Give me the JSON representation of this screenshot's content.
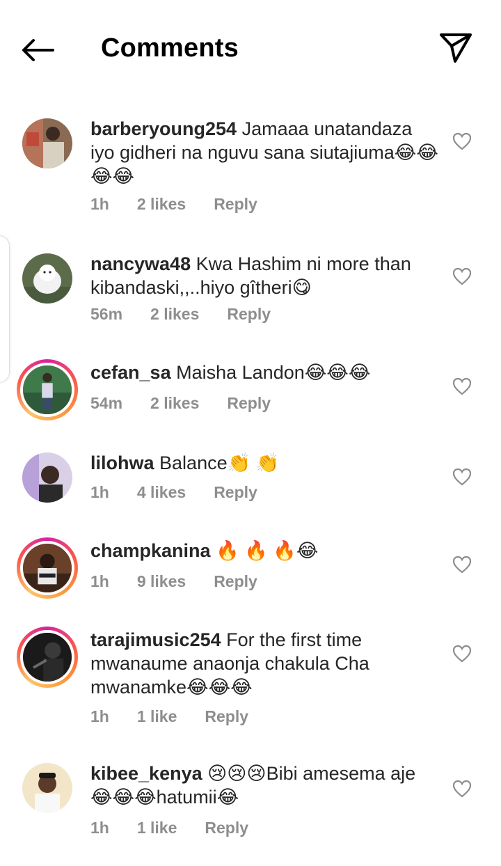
{
  "header": {
    "title": "Comments",
    "back_icon": "arrow-left-icon",
    "share_icon": "send-icon"
  },
  "comments": [
    {
      "username": "barberyoung254",
      "text": "Jamaaa unatandaza iyo gidheri na nguvu sana siutajiuma😂😂😂😂",
      "time": "1h",
      "likes": "2 likes",
      "reply": "Reply"
    },
    {
      "username": "nancywa48",
      "text": "Kwa Hashim ni more than kibandaski,,..hiyo gîtheri😋",
      "time": "56m",
      "likes": "2 likes",
      "reply": "Reply"
    },
    {
      "username": "cefan_sa",
      "text": "Maisha Landon😂😂😂",
      "time": "54m",
      "likes": "2 likes",
      "reply": "Reply"
    },
    {
      "username": "lilohwa",
      "text": "Balance👏 👏",
      "time": "1h",
      "likes": "4 likes",
      "reply": "Reply"
    },
    {
      "username": "champkanina",
      "text": "🔥 🔥 🔥😂",
      "time": "1h",
      "likes": "9 likes",
      "reply": "Reply"
    },
    {
      "username": "tarajimusic254",
      "text": "For the first time mwanaume anaonja chakula Cha mwanamke😂😂😂",
      "time": "1h",
      "likes": "1 like",
      "reply": "Reply"
    },
    {
      "username": "kibee_kenya",
      "text": "😢😢😢Bibi amesema aje 😂😂😂hatumii😂",
      "time": "1h",
      "likes": "1 like",
      "reply": "Reply"
    }
  ],
  "colors": {
    "story_ring": "#d6249f",
    "meta_gray": "#8e8e8e",
    "text": "#262626"
  }
}
